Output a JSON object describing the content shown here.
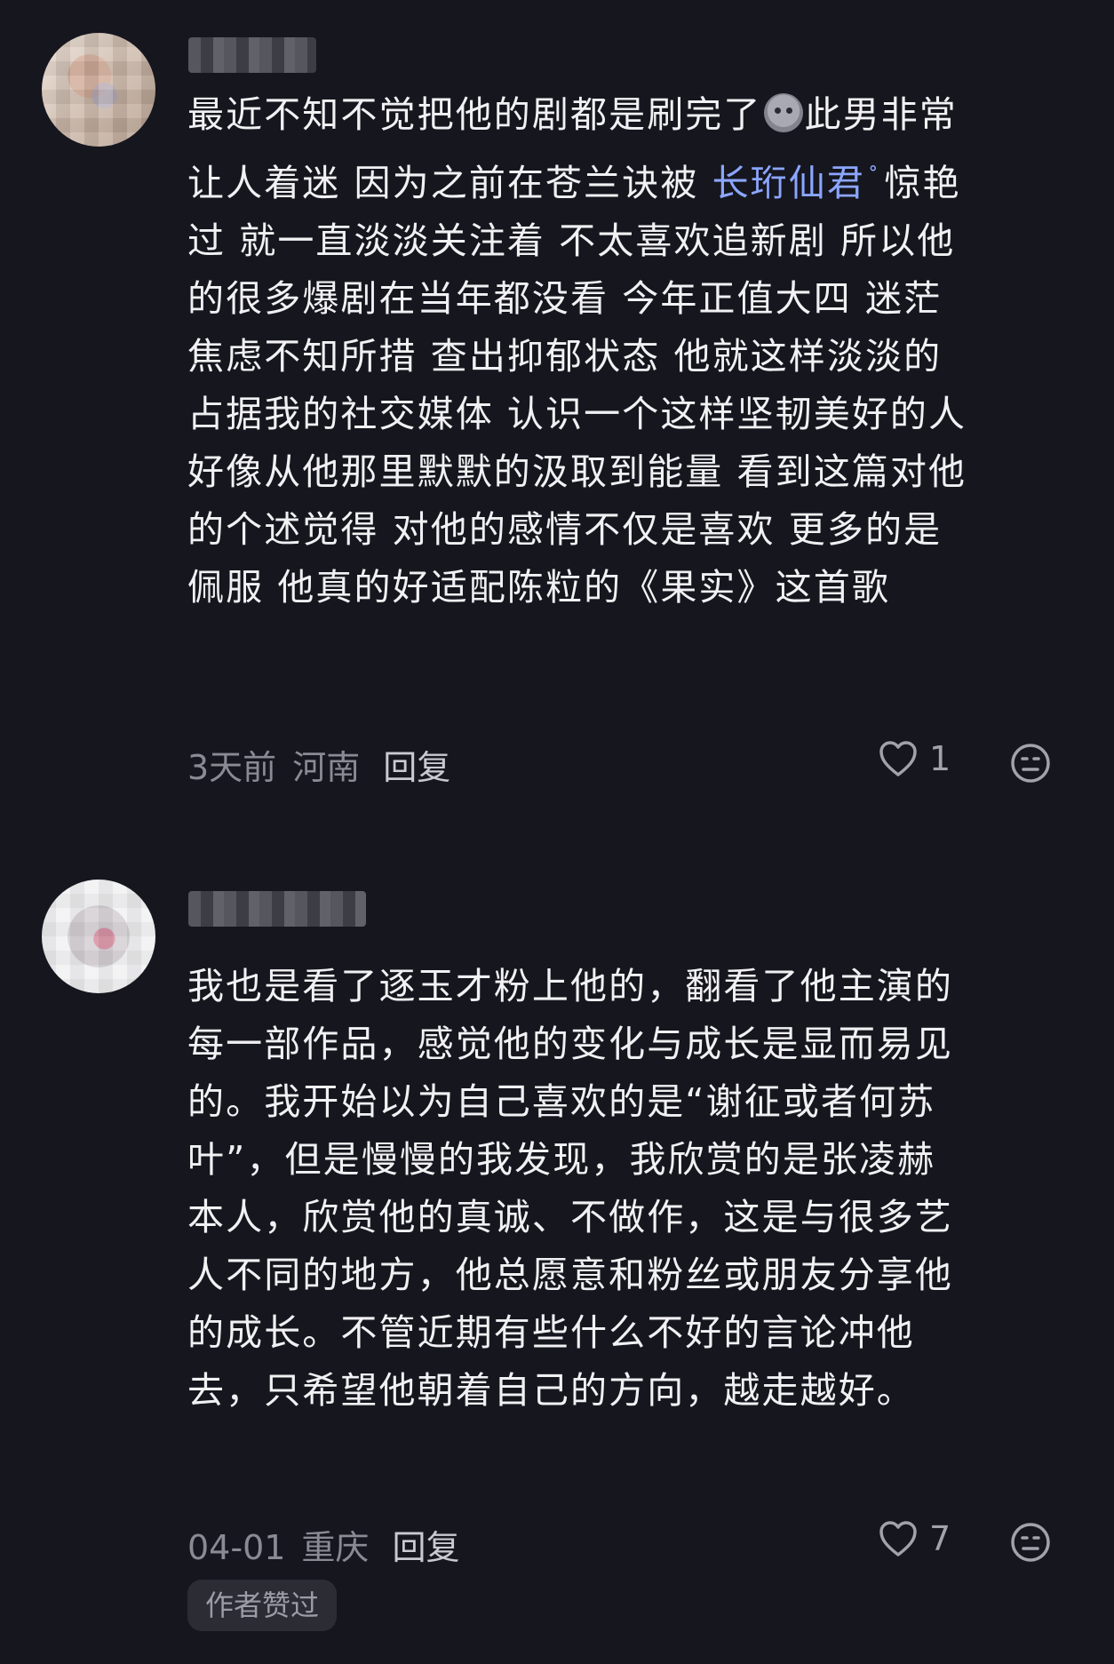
{
  "comments": [
    {
      "avatar": "avatar-image",
      "text_lines": [
        "最近不知不觉把他的剧都是刷完了",
        "让人着迷 因为之前在苍兰诀被 ",
        "过 就一直淡淡关注着 不太喜欢追新剧 所以他",
        "的很多爆剧在当年都没看 今年正值大四 迷茫",
        "焦虑不知所措 查出抑郁状态 他就这样淡淡的",
        "占据我的社交媒体 认识一个这样坚韧美好的人",
        "好像从他那里默默的汲取到能量 看到这篇对他",
        "的个述觉得 对他的感情不仅是喜欢 更多的是",
        "佩服 他真的好适配陈粒的《果实》这首歌"
      ],
      "line1_tail": "此男非常",
      "line2_link": "长珩仙君",
      "line2_tail": "惊艳",
      "time": "3天前",
      "location": "河南",
      "reply_label": "回复",
      "likes": "1"
    },
    {
      "avatar": "avatar-image",
      "text_lines": [
        "我也是看了逐玉才粉上他的，翻看了他主演的",
        "每一部作品，感觉他的变化与成长是显而易见",
        "的。我开始以为自己喜欢的是“谢征或者何苏",
        "叶”，但是慢慢的我发现，我欣赏的是张凌赫",
        "本人，欣赏他的真诚、不做作，这是与很多艺",
        "人不同的地方，他总愿意和粉丝或朋友分享他",
        "的成长。不管近期有些什么不好的言论冲他",
        "去，只希望他朝着自己的方向，越走越好。"
      ],
      "time": "04-01",
      "location": "重庆",
      "reply_label": "回复",
      "likes": "7",
      "badge": "作者赞过"
    }
  ],
  "colors": {
    "background": "#16161e",
    "text": "#f1f1f4",
    "meta": "#8a8a94",
    "link": "#8ba6ff"
  },
  "icons": {
    "like": "heart-outline-icon",
    "dislike": "dislike-face-icon",
    "link": "search-link-icon"
  }
}
